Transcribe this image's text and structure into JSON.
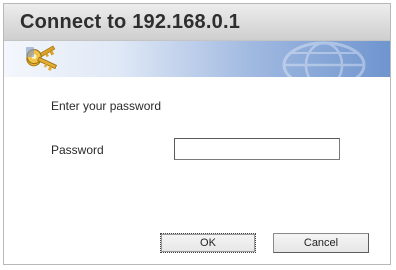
{
  "window": {
    "title": "Connect to 192.168.0.1"
  },
  "banner": {
    "icon": "keys-icon",
    "watermark": "globe-watermark"
  },
  "form": {
    "prompt": "Enter your password",
    "password_label": "Password",
    "password_value": ""
  },
  "buttons": {
    "ok_label": "OK",
    "cancel_label": "Cancel"
  },
  "colors": {
    "banner_start": "#f4f7fc",
    "banner_end": "#6f95cf",
    "title_text": "#2e2e2e"
  }
}
